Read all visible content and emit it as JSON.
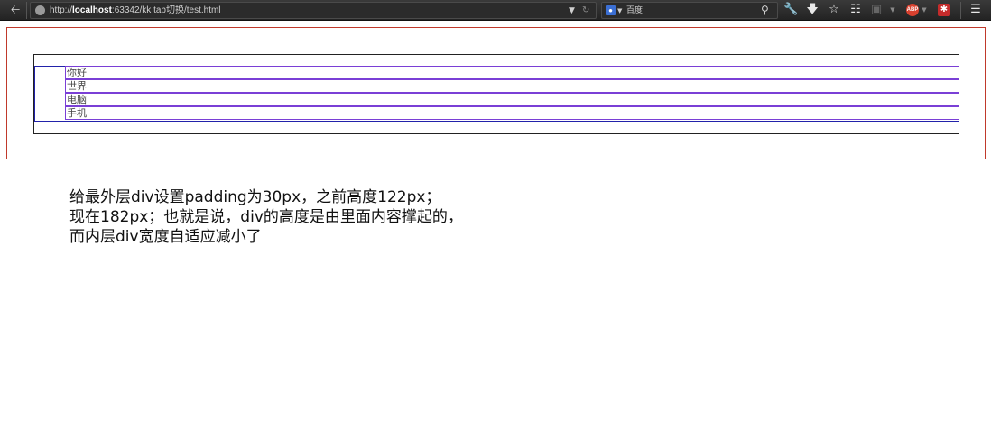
{
  "browser": {
    "url_prefix": "http://",
    "url_host": "localhost",
    "url_path": ":63342/kk tab切换/test.html",
    "search_engine": "百度",
    "search_engine_icon": "baidu-paw-icon",
    "badge_label": "ABP"
  },
  "page": {
    "list_items": [
      {
        "label": "你好"
      },
      {
        "label": "世界"
      },
      {
        "label": "电脑"
      },
      {
        "label": "手机"
      }
    ],
    "note_lines": [
      "给最外层div设置padding为30px，之前高度122px；",
      "现在182px；也就是说，div的高度是由里面内容撑起的，",
      "而内层div宽度自适应减小了"
    ]
  },
  "colors": {
    "outer_border": "#c0392b",
    "list_border": "#2222aa",
    "row_border": "#7a3fd6",
    "toolbar_bg": "#2b2b2b"
  }
}
